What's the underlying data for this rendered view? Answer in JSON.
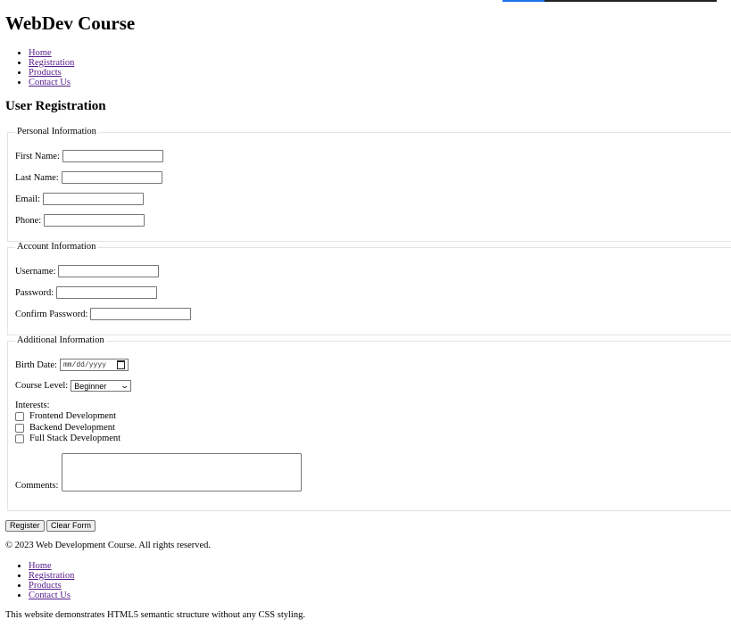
{
  "site_title": "WebDev Course",
  "nav": [
    "Home",
    "Registration",
    "Products",
    "Contact Us"
  ],
  "page_title": "User Registration",
  "personal": {
    "legend": "Personal Information",
    "first_name": "First Name:",
    "last_name": "Last Name:",
    "email": "Email:",
    "phone": "Phone:"
  },
  "account": {
    "legend": "Account Information",
    "username": "Username:",
    "password": "Password:",
    "confirm_password": "Confirm Password:"
  },
  "additional": {
    "legend": "Additional Information",
    "birth_date": "Birth Date:",
    "birth_date_placeholder": "mm/dd/yyyy",
    "course_level": "Course Level:",
    "course_level_value": "Beginner",
    "interests": "Interests:",
    "interest_options": [
      "Frontend Development",
      "Backend Development",
      "Full Stack Development"
    ],
    "comments": "Comments:"
  },
  "buttons": {
    "register": "Register",
    "clear": "Clear Form"
  },
  "footer": {
    "copyright": "© 2023 Web Development Course. All rights reserved.",
    "nav": [
      "Home",
      "Registration",
      "Products",
      "Contact Us"
    ],
    "note": "This website demonstrates HTML5 semantic structure without any CSS styling."
  }
}
